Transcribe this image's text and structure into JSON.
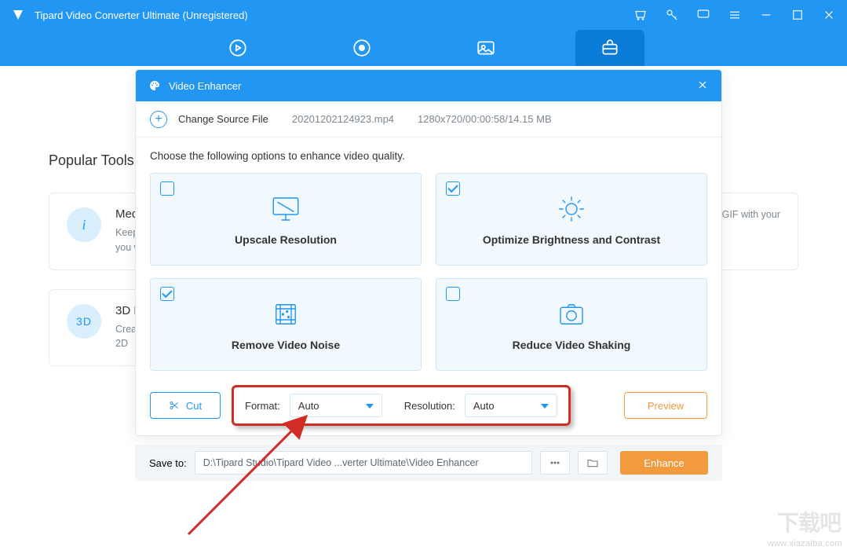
{
  "titlebar": {
    "title": "Tipard Video Converter Ultimate (Unregistered)"
  },
  "bg": {
    "section_title": "Popular Tools",
    "cards": [
      {
        "title": "Med",
        "desc1": "Keep",
        "desc2": "you w"
      },
      {
        "title_right": "",
        "desc_right": "GIF with your"
      },
      {
        "title": "3D M",
        "desc1": "Crea",
        "desc2": "2D"
      }
    ]
  },
  "modal": {
    "title": "Video Enhancer",
    "change_source": "Change Source File",
    "filename": "20201202124923.mp4",
    "meta": "1280x720/00:00:58/14.15 MB",
    "instruction": "Choose the following options to enhance video quality.",
    "options": [
      {
        "label": "Upscale Resolution",
        "checked": false
      },
      {
        "label": "Optimize Brightness and Contrast",
        "checked": true
      },
      {
        "label": "Remove Video Noise",
        "checked": true
      },
      {
        "label": "Reduce Video Shaking",
        "checked": false
      }
    ],
    "cut": "Cut",
    "format_label": "Format:",
    "format_value": "Auto",
    "resolution_label": "Resolution:",
    "resolution_value": "Auto",
    "preview": "Preview"
  },
  "footer": {
    "save_to_label": "Save to:",
    "path": "D:\\Tipard Studio\\Tipard Video ...verter Ultimate\\Video Enhancer",
    "enhance": "Enhance"
  },
  "watermark": {
    "text": "www.xiazaiba.com",
    "logo": "下载吧"
  }
}
